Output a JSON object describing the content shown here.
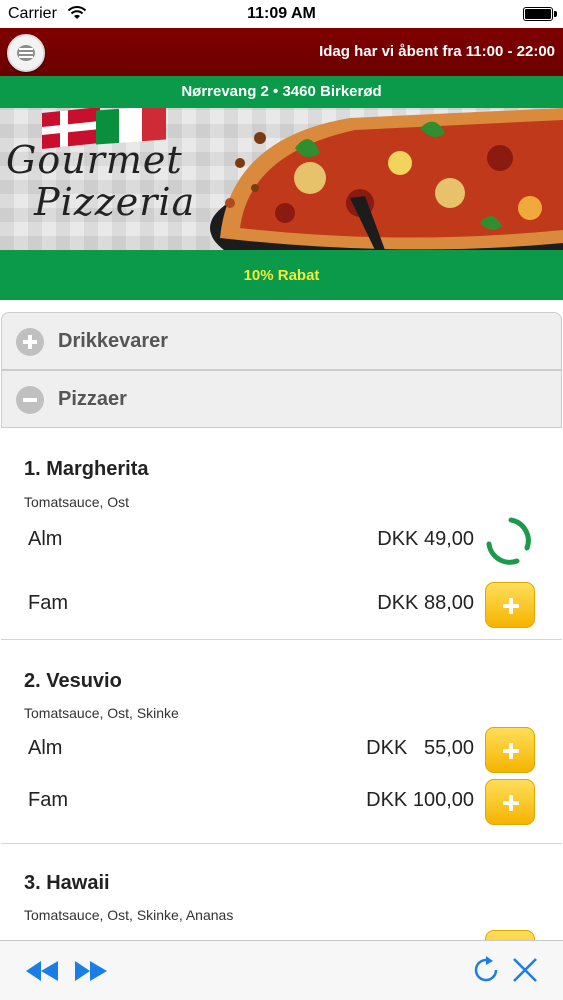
{
  "status_bar": {
    "carrier": "Carrier",
    "time": "11:09 AM"
  },
  "header": {
    "opening_hours": "Idag har vi åbent fra 11:00 - 22:00",
    "address": "Nørrevang 2 • 3460 Birkerød"
  },
  "banner": {
    "logo_line1": "Gourmet",
    "logo_line2": "Pizzeria"
  },
  "discount": "10% Rabat",
  "colors": {
    "top_bar": "#7a0000",
    "green_bar": "#0a9a4a",
    "discount_text": "#f4ea3b",
    "add_button": "#f5b400",
    "toolbar_icons": "#1a7ee6"
  },
  "sections": [
    {
      "label": "Drikkevarer",
      "state": "collapsed",
      "icon": "plus-circle-icon"
    },
    {
      "label": "Pizzaer",
      "state": "expanded",
      "icon": "minus-circle-icon"
    }
  ],
  "pizzas": [
    {
      "title": "1. Margherita",
      "description": "Tomatsauce, Ost",
      "options": [
        {
          "size": "Alm",
          "price": "DKK 49,00",
          "state": "loading"
        },
        {
          "size": "Fam",
          "price": "DKK 88,00",
          "state": "add"
        }
      ]
    },
    {
      "title": "2. Vesuvio",
      "description": "Tomatsauce, Ost, Skinke",
      "options": [
        {
          "size": "Alm",
          "price": "DKK   55,00",
          "state": "add"
        },
        {
          "size": "Fam",
          "price": "DKK 100,00",
          "state": "add"
        }
      ]
    },
    {
      "title": "3. Hawaii",
      "description": "Tomatsauce, Ost, Skinke, Ananas",
      "options": []
    }
  ],
  "toolbar": {
    "icons": [
      "back-icon",
      "forward-icon",
      "refresh-icon",
      "close-icon"
    ]
  }
}
